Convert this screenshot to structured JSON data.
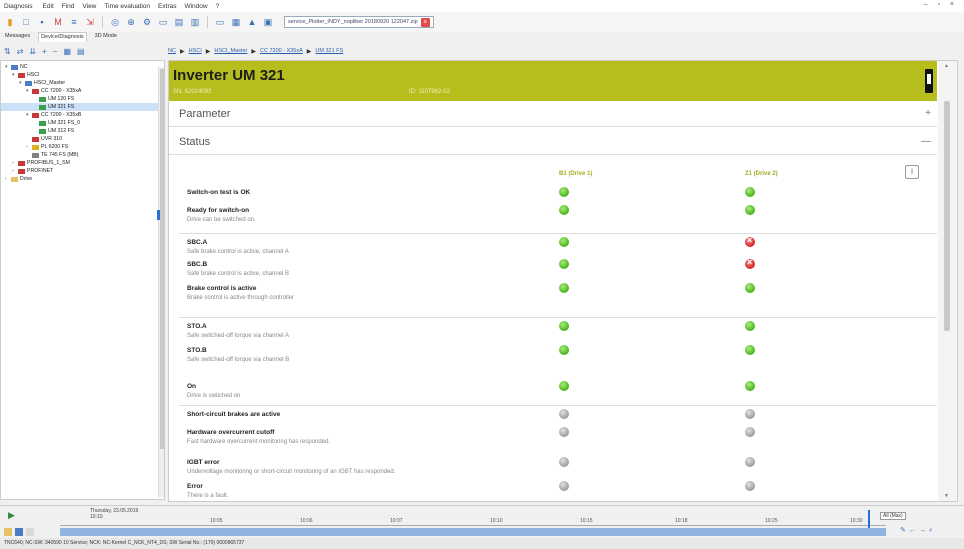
{
  "app": {
    "title": "Diagnosis",
    "menu": [
      "Edit",
      "Find",
      "View",
      "Time evaluation",
      "Extras",
      "Window",
      "?"
    ]
  },
  "toolbar": {
    "file_tab": "service_Plotter_INDY_nopliber 20180920 122047.zip"
  },
  "left_tabs": [
    "Messages",
    "Device/Diagnosis",
    "3D Mode"
  ],
  "tree": [
    {
      "label": "NC",
      "indent": 0,
      "icon": "blue",
      "arrow": "▾"
    },
    {
      "label": "HSCI",
      "indent": 1,
      "icon": "red",
      "arrow": "▾"
    },
    {
      "label": "HSCI_Master",
      "indent": 2,
      "icon": "blue",
      "arrow": "▾"
    },
    {
      "label": "CC 7200 - X35xA",
      "indent": 3,
      "icon": "red",
      "arrow": "▾"
    },
    {
      "label": "UM 120 FS",
      "indent": 4,
      "icon": "green",
      "arrow": ""
    },
    {
      "label": "UM 321 FS",
      "indent": 4,
      "icon": "green",
      "arrow": "",
      "selected": true
    },
    {
      "label": "CC 7200 - X35xB",
      "indent": 3,
      "icon": "red",
      "arrow": "▾"
    },
    {
      "label": "UM 321 FS_0",
      "indent": 4,
      "icon": "green",
      "arrow": ""
    },
    {
      "label": "UM 312 FS",
      "indent": 4,
      "icon": "green",
      "arrow": ""
    },
    {
      "label": "UVR 310",
      "indent": 3,
      "icon": "red",
      "arrow": ""
    },
    {
      "label": "PL 6200 FS",
      "indent": 3,
      "icon": "yellow",
      "arrow": "›"
    },
    {
      "label": "TE 745 FS (MB)",
      "indent": 3,
      "icon": "gray",
      "arrow": ""
    },
    {
      "label": "PROFIBUS_1_SM",
      "indent": 1,
      "icon": "red",
      "arrow": "›"
    },
    {
      "label": "PROFINET",
      "indent": 1,
      "icon": "red",
      "arrow": "›"
    },
    {
      "label": "Drive",
      "indent": 0,
      "icon": "folder",
      "arrow": "›"
    }
  ],
  "breadcrumb": [
    "NC",
    "HSCI",
    "HSCI_Master",
    "CC 7200 - X35xA",
    "UM 321 FS"
  ],
  "device": {
    "title": "Inverter UM 321",
    "snr": "SN: 62024093",
    "id": "ID: 1107962-02"
  },
  "sections": {
    "parameter": {
      "label": "Parameter",
      "toggle": "+"
    },
    "status": {
      "label": "Status",
      "toggle": "—"
    }
  },
  "status_table": {
    "col1": "B1 (Drive 1)",
    "col2": "Z1 (Drive 2)",
    "info_button": "i",
    "rows": [
      {
        "label": "Switch-on test is OK",
        "desc": "",
        "d1": "green",
        "d2": "green"
      },
      {
        "label": "Ready for switch-on",
        "desc": "Drive can be switched on.",
        "d1": "green",
        "d2": "green"
      },
      {
        "label": "SBC.A",
        "desc": "Safe brake control is active, channel A",
        "d1": "green",
        "d2": "red"
      },
      {
        "label": "SBC.B",
        "desc": "Safe brake control is active, channel B",
        "d1": "green",
        "d2": "red"
      },
      {
        "label": "Brake control is active",
        "desc": "Brake control is active through controller",
        "d1": "green",
        "d2": "green"
      },
      {
        "label": "STO.A",
        "desc": "Safe switched-off torque via channel A",
        "d1": "green",
        "d2": "green"
      },
      {
        "label": "STO.B",
        "desc": "Safe switched-off torque via channel B",
        "d1": "green",
        "d2": "green"
      },
      {
        "label": "On",
        "desc": "Drive is switched on",
        "d1": "green",
        "d2": "green"
      },
      {
        "label": "Short-circuit brakes are active",
        "desc": "",
        "d1": "gray",
        "d2": "gray"
      },
      {
        "label": "Hardware overcurrent cutoff",
        "desc": "Fast hardware overcurrent monitoring has responded.",
        "d1": "gray",
        "d2": "gray"
      },
      {
        "label": "IGBT error",
        "desc": "Undervoltage monitoring or short-circuit monitoring of an IGBT has responded.",
        "d1": "gray",
        "d2": "gray"
      },
      {
        "label": "Error",
        "desc": "There is a fault.",
        "d1": "gray",
        "d2": "gray"
      }
    ]
  },
  "timeline": {
    "date_line1": "Thursday, 23.05.2019",
    "date_line2": "10:10",
    "ticks": [
      "10:05",
      "10:06",
      "10:07",
      "10:10",
      "10:15",
      "10:18",
      "10:25",
      "10:30"
    ],
    "zoom": "All (Max)"
  },
  "statusbar": "TNC640; NC-SW: 340590 10 Service; NCK: NC-Kernel C_NCK_NT4_DS; SW Serial No.: (170) 0000965737"
}
